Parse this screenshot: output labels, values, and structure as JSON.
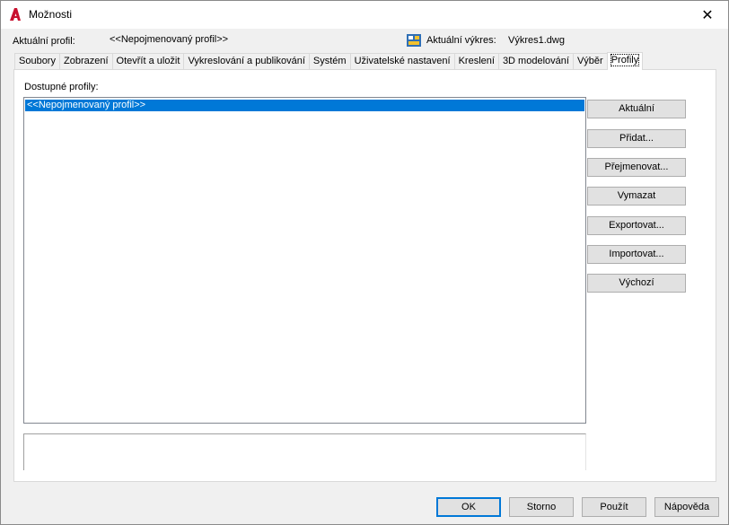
{
  "window": {
    "title": "Možnosti",
    "close_glyph": "✕",
    "app_icon": "autocad-icon",
    "accent_color": "#0078d7",
    "app_icon_color": "#c8102e"
  },
  "header": {
    "current_profile_label": "Aktuální profil:",
    "current_profile_value": "<<Nepojmenovaný profil>>",
    "current_drawing_label": "Aktuální výkres:",
    "current_drawing_value": "Výkres1.dwg",
    "drawing_icon": "drawing-file-icon"
  },
  "tabs": [
    {
      "label": "Soubory"
    },
    {
      "label": "Zobrazení"
    },
    {
      "label": "Otevřít a uložit"
    },
    {
      "label": "Vykreslování a publikování"
    },
    {
      "label": "Systém"
    },
    {
      "label": "Uživatelské nastavení"
    },
    {
      "label": "Kreslení"
    },
    {
      "label": "3D modelování"
    },
    {
      "label": "Výběr"
    },
    {
      "label": "Profily",
      "active": true
    }
  ],
  "profiles": {
    "available_label": "Dostupné profily:",
    "items": [
      "<<Nepojmenovaný profil>>"
    ],
    "selected_index": 0,
    "description": ""
  },
  "side_buttons": {
    "set_current": "Aktuální",
    "add": "Přidat...",
    "rename": "Přejmenovat...",
    "delete": "Vymazat",
    "export": "Exportovat...",
    "import": "Importovat...",
    "reset": "Výchozí"
  },
  "bottom_buttons": {
    "ok": "OK",
    "cancel": "Storno",
    "apply": "Použít",
    "help": "Nápověda"
  }
}
